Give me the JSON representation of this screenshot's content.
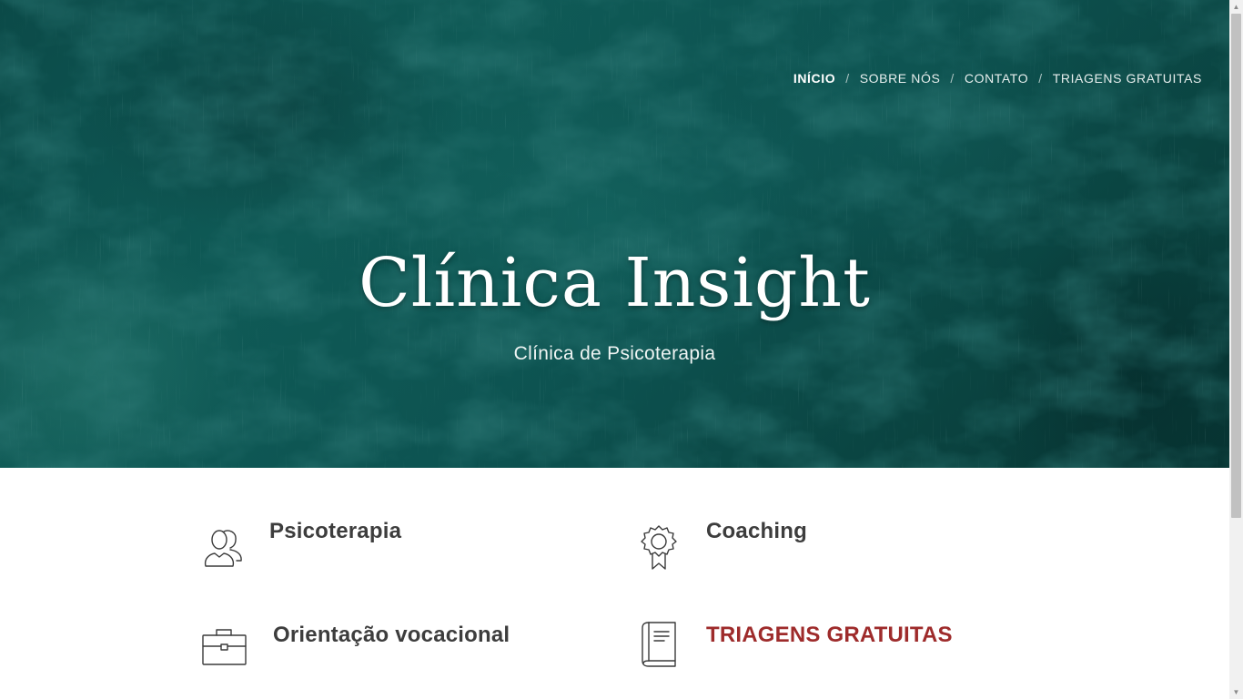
{
  "nav": {
    "items": [
      {
        "label": "INÍCIO",
        "active": true
      },
      {
        "label": "SOBRE NÓS",
        "active": false
      },
      {
        "label": "CONTATO",
        "active": false
      },
      {
        "label": "TRIAGENS GRATUITAS",
        "active": false
      }
    ],
    "separator": "/"
  },
  "hero": {
    "title": "Clínica Insight",
    "subtitle": "Clínica de Psicoterapia",
    "background_color": "#0d5351"
  },
  "services": [
    {
      "label": "Psicoterapia",
      "icon": "users-icon",
      "highlight": false
    },
    {
      "label": "Coaching",
      "icon": "award-icon",
      "highlight": false
    },
    {
      "label": "Orientação vocacional",
      "icon": "briefcase-icon",
      "highlight": false
    },
    {
      "label": "TRIAGENS GRATUITAS",
      "icon": "book-icon",
      "highlight": true
    }
  ],
  "colors": {
    "text_dark": "#3d3d3d",
    "accent_red": "#9e2b2b",
    "icon_stroke": "#3a3a3a"
  },
  "scrollbar": {
    "position_fraction": 0.0,
    "visible_fraction": 0.75
  }
}
